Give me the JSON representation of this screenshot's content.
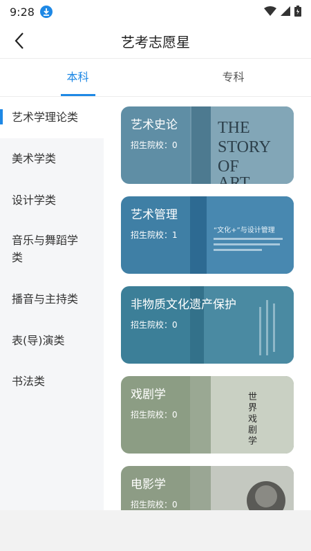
{
  "status_bar": {
    "time": "9:28"
  },
  "nav": {
    "title": "艺考志愿星"
  },
  "tabs": [
    {
      "label": "本科",
      "active": true
    },
    {
      "label": "专科",
      "active": false
    }
  ],
  "sidebar": {
    "items": [
      {
        "label": "艺术学理论类",
        "active": true
      },
      {
        "label": "美术学类",
        "active": false
      },
      {
        "label": "设计学类",
        "active": false
      },
      {
        "label": "音乐与舞蹈学类",
        "active": false
      },
      {
        "label": "播音与主持类",
        "active": false
      },
      {
        "label": "表(导)演类",
        "active": false
      },
      {
        "label": "书法类",
        "active": false
      }
    ]
  },
  "cards": [
    {
      "title": "艺术史论",
      "subtitle": "招生院校：0",
      "bg": "#5f8ea5",
      "book_text": [
        "THE",
        "STORY",
        "OF",
        "ART"
      ]
    },
    {
      "title": "艺术管理",
      "subtitle": "招生院校：1",
      "bg": "#3f7fa5",
      "book_text": [
        "“文化+”与设计管理"
      ]
    },
    {
      "title": "非物质文化遗产保护",
      "subtitle": "招生院校：0",
      "bg": "#3c7f98",
      "book_text": []
    },
    {
      "title": "戏剧学",
      "subtitle": "招生院校：0",
      "bg": "#8c9d84",
      "book_text": [
        "世",
        "界",
        "戏",
        "剧",
        "学"
      ]
    },
    {
      "title": "电影学",
      "subtitle": "招生院校：0",
      "bg": "#8d9c85",
      "book_text": []
    }
  ],
  "colors": {
    "accent": "#1e88e5",
    "sidebar_bg": "#f5f6f8"
  }
}
